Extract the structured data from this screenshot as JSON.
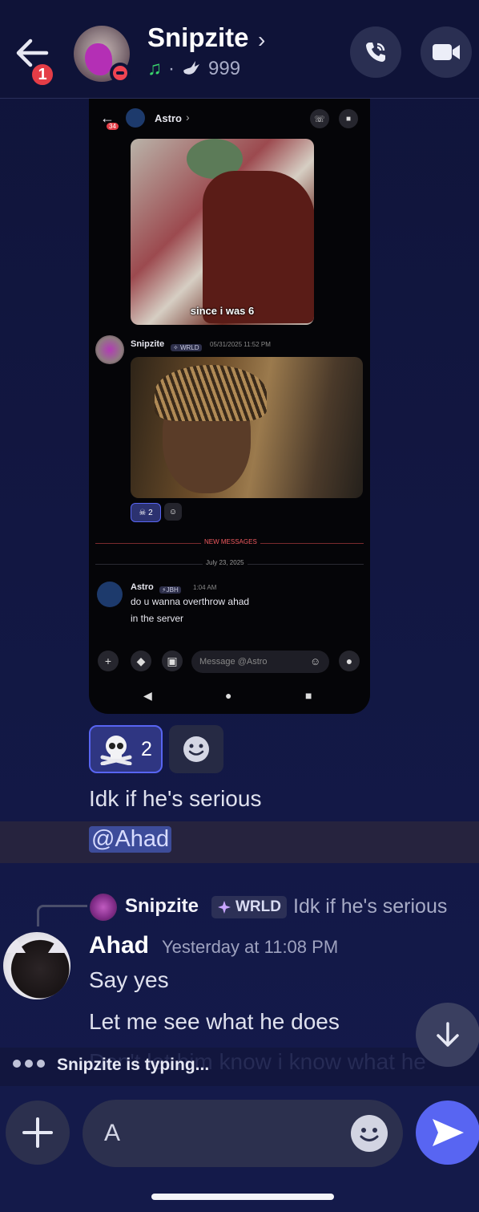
{
  "header": {
    "badge_count": "1",
    "contact_name": "Snipzite",
    "status_separator": "·",
    "status_count": "999"
  },
  "embedded_screenshot": {
    "contact_name": "Astro",
    "unread_badge": "34",
    "meme_caption": "since i was 6",
    "message_author": "Snipzite",
    "author_tag": "WRLD",
    "message_time": "05/31/2025 11:52 PM",
    "reaction_count": "2",
    "new_messages_label": "NEW MESSAGES",
    "date_divider": "July 23, 2025",
    "astro_author": "Astro",
    "astro_tag": "JBH",
    "astro_time": "1:04 AM",
    "astro_line1": "do u wanna overthrow ahad",
    "astro_line2": "in the server",
    "input_placeholder": "Message @Astro"
  },
  "reactions": [
    {
      "emoji_icon": "skull-crossbones-icon",
      "count": "2",
      "selected": true
    },
    {
      "emoji_icon": "add-reaction-icon",
      "selected": false
    }
  ],
  "messages": {
    "caption": "Idk if he's serious",
    "mention": "@Ahad",
    "reply": {
      "author": "Snipzite",
      "tag": "WRLD",
      "preview": "Idk if he's serious"
    },
    "ahad": {
      "author": "Ahad",
      "timestamp": "Yesterday at 11:08 PM",
      "line1": "Say yes",
      "line2": "Let me see what he does",
      "line3_partial": "Don't let him know i know what he"
    }
  },
  "typing": {
    "text": "Snipzite is typing..."
  },
  "composer": {
    "input_value": "A"
  },
  "colors": {
    "accent": "#5865f2",
    "dnd_red": "#ef4452",
    "badge_red": "#e43d47",
    "online_green": "#3ad66c"
  }
}
